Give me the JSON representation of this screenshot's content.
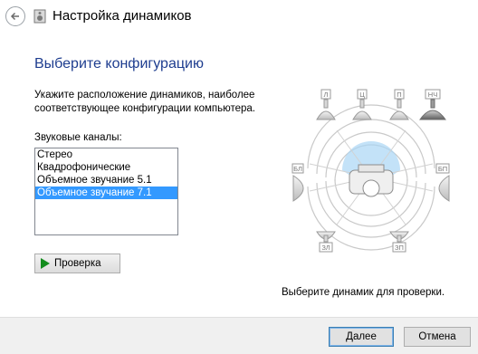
{
  "window": {
    "title": "Настройка динамиков"
  },
  "main": {
    "heading": "Выберите конфигурацию",
    "instruction": "Укажите расположение динамиков, наиболее соответствующее конфигурации компьютера.",
    "channels_label": "Звуковые каналы:",
    "channels": [
      {
        "label": "Стерео",
        "selected": false
      },
      {
        "label": "Квадрофонические",
        "selected": false
      },
      {
        "label": "Объемное звучание 5.1",
        "selected": false
      },
      {
        "label": "Объемное звучание 7.1",
        "selected": true
      }
    ],
    "test_button": "Проверка",
    "hint": "Выберите динамик для проверки."
  },
  "speakers": {
    "front_left": "Л",
    "center": "Ц",
    "front_right": "П",
    "subwoofer": "НЧ",
    "side_left": "БЛ",
    "side_right": "БП",
    "rear_left": "ЗЛ",
    "rear_right": "ЗП"
  },
  "footer": {
    "next": "Далее",
    "cancel": "Отмена"
  },
  "colors": {
    "heading": "#1e3d8f",
    "selection": "#3399ff",
    "play": "#138c1d"
  }
}
